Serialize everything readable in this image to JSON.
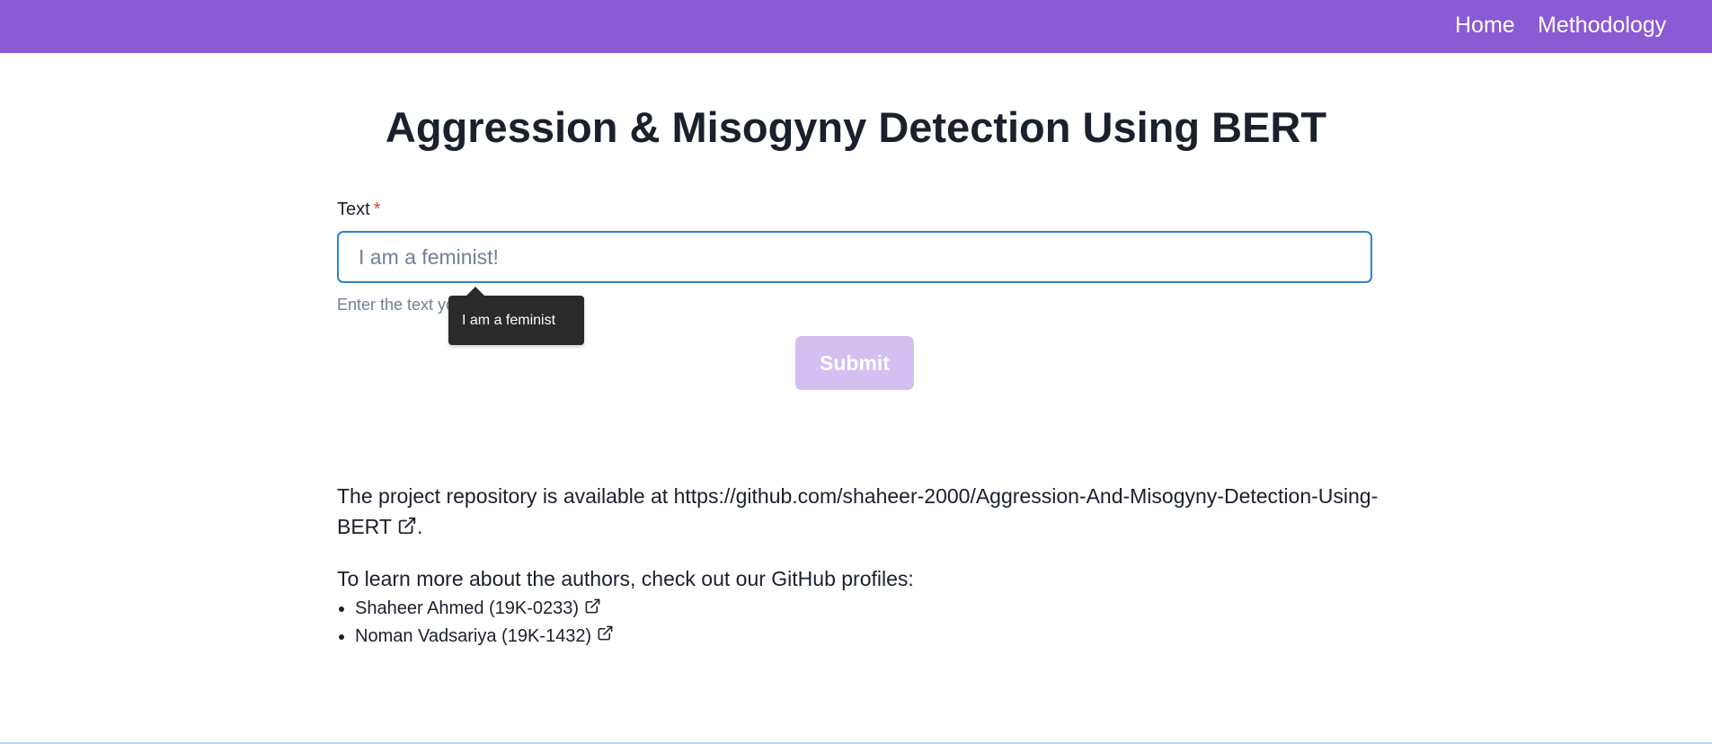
{
  "navbar": {
    "links": [
      {
        "label": "Home"
      },
      {
        "label": "Methodology"
      }
    ],
    "background": "#8a5bd4"
  },
  "page": {
    "title": "Aggression & Misogyny Detection Using BERT"
  },
  "form": {
    "label": "Text",
    "required_marker": "*",
    "input_placeholder": "I am a feminist!",
    "input_value": "",
    "helper_text": "Enter the text yo",
    "tooltip_text": "I am a feminist",
    "submit_label": "Submit",
    "submit_disabled": true
  },
  "repo": {
    "text_prefix": "The project repository is available at ",
    "link_text": "https://github.com/shaheer-2000/Aggression-And-Misogyny-Detection-Using-BERT",
    "suffix": "."
  },
  "authors": {
    "intro": "To learn more about the authors, check out our GitHub profiles:",
    "items": [
      {
        "label": "Shaheer Ahmed (19K-0233)"
      },
      {
        "label": "Noman Vadsariya (19K-1432)"
      }
    ]
  },
  "icons": {
    "external_link": "external-link-icon"
  },
  "colors": {
    "accent": "#8a5bd4",
    "submit_disabled": "#d3c0f0",
    "input_focus_border": "#3182ce",
    "required": "#e53e3e",
    "tooltip_bg": "#2a2a2a"
  }
}
